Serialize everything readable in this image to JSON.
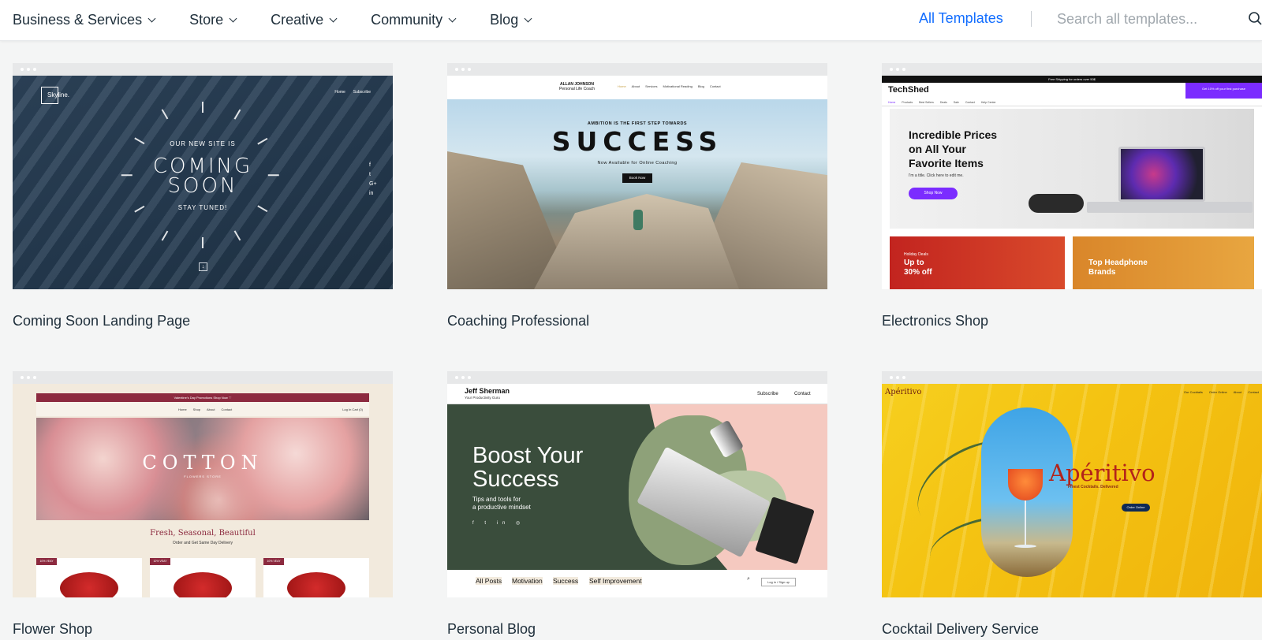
{
  "nav": {
    "menu": [
      {
        "label": "Business & Services"
      },
      {
        "label": "Store"
      },
      {
        "label": "Creative"
      },
      {
        "label": "Community"
      },
      {
        "label": "Blog"
      }
    ],
    "all_templates": "All Templates",
    "search_placeholder": "Search all templates...",
    "accent_color": "#116dff"
  },
  "templates": [
    {
      "title": "Coming Soon Landing Page",
      "preview": {
        "logo": "Skyline.",
        "nav": [
          "Home",
          "Subscribe"
        ],
        "eyebrow": "OUR NEW SITE IS",
        "headline_1": "COMING",
        "headline_2": "SOON",
        "tagline": "STAY TUNED!",
        "social_icons": [
          "f",
          "t",
          "G+",
          "in"
        ]
      }
    },
    {
      "title": "Coaching Professional",
      "preview": {
        "brand": "ALLAN JOHNSON",
        "brand_sub": "Personal Life Coach",
        "nav": [
          "Home",
          "About",
          "Services",
          "Motivational Reading",
          "Blog",
          "Contact"
        ],
        "eyebrow": "AMBITION IS THE FIRST STEP TOWARDS",
        "headline": "SUCCESS",
        "sub": "Now Available for Online Coaching",
        "button": "Book Now"
      }
    },
    {
      "title": "Electronics Shop",
      "preview": {
        "promo": "Free Shipping for orders over 50$",
        "brand": "TechShed",
        "cta": "Get 10% off your first purchase",
        "subnav": [
          "Home",
          "Products",
          "Best Sellers",
          "Deals",
          "Sale",
          "Contact",
          "Help Center"
        ],
        "headline_1": "Incredible Prices",
        "headline_2": "on All Your",
        "headline_3": "Favorite Items",
        "sub": "I'm a title. Click here to edit me.",
        "button": "Shop Now",
        "deal1_label": "Holiday Deals",
        "deal1_big_1": "Up to",
        "deal1_big_2": "30% off",
        "deal2_big_1": "Top Headphone",
        "deal2_big_2": "Brands"
      }
    },
    {
      "title": "Flower Shop",
      "preview": {
        "band": "Valentine's Day Promotions Shop Now ♡",
        "nav": [
          "Home",
          "Shop",
          "About",
          "Contact"
        ],
        "login": "Log In   Cart (0)",
        "brand": "COTTON",
        "brand_sub": "FLOWERS STORE",
        "tagline": "Fresh, Seasonal, Beautiful",
        "tag_sub": "Order and Get Same Day Delivery",
        "badge": "10% VEAY"
      }
    },
    {
      "title": "Personal Blog",
      "preview": {
        "name": "Jeff Sherman",
        "name_sub": "Your Productivity Guru",
        "subscribe": "Subscribe",
        "contact": "Contact",
        "headline_1": "Boost Your",
        "headline_2": "Success",
        "sub_1": "Tips and tools for",
        "sub_2": "a productive mindset",
        "social": "f t in ◎",
        "footer_links": [
          "All Posts",
          "Motivation",
          "Success",
          "Self Improvement"
        ],
        "login": "Log in / Sign up"
      }
    },
    {
      "title": "Cocktail Delivery Service",
      "preview": {
        "brand": "Apéritivo",
        "nav": [
          "Our Cocktails",
          "Order Online",
          "About",
          "Contact"
        ],
        "headline": "Apéritivo",
        "sub": "Finest Cocktails. Delivered",
        "button": "Order Online"
      }
    }
  ]
}
